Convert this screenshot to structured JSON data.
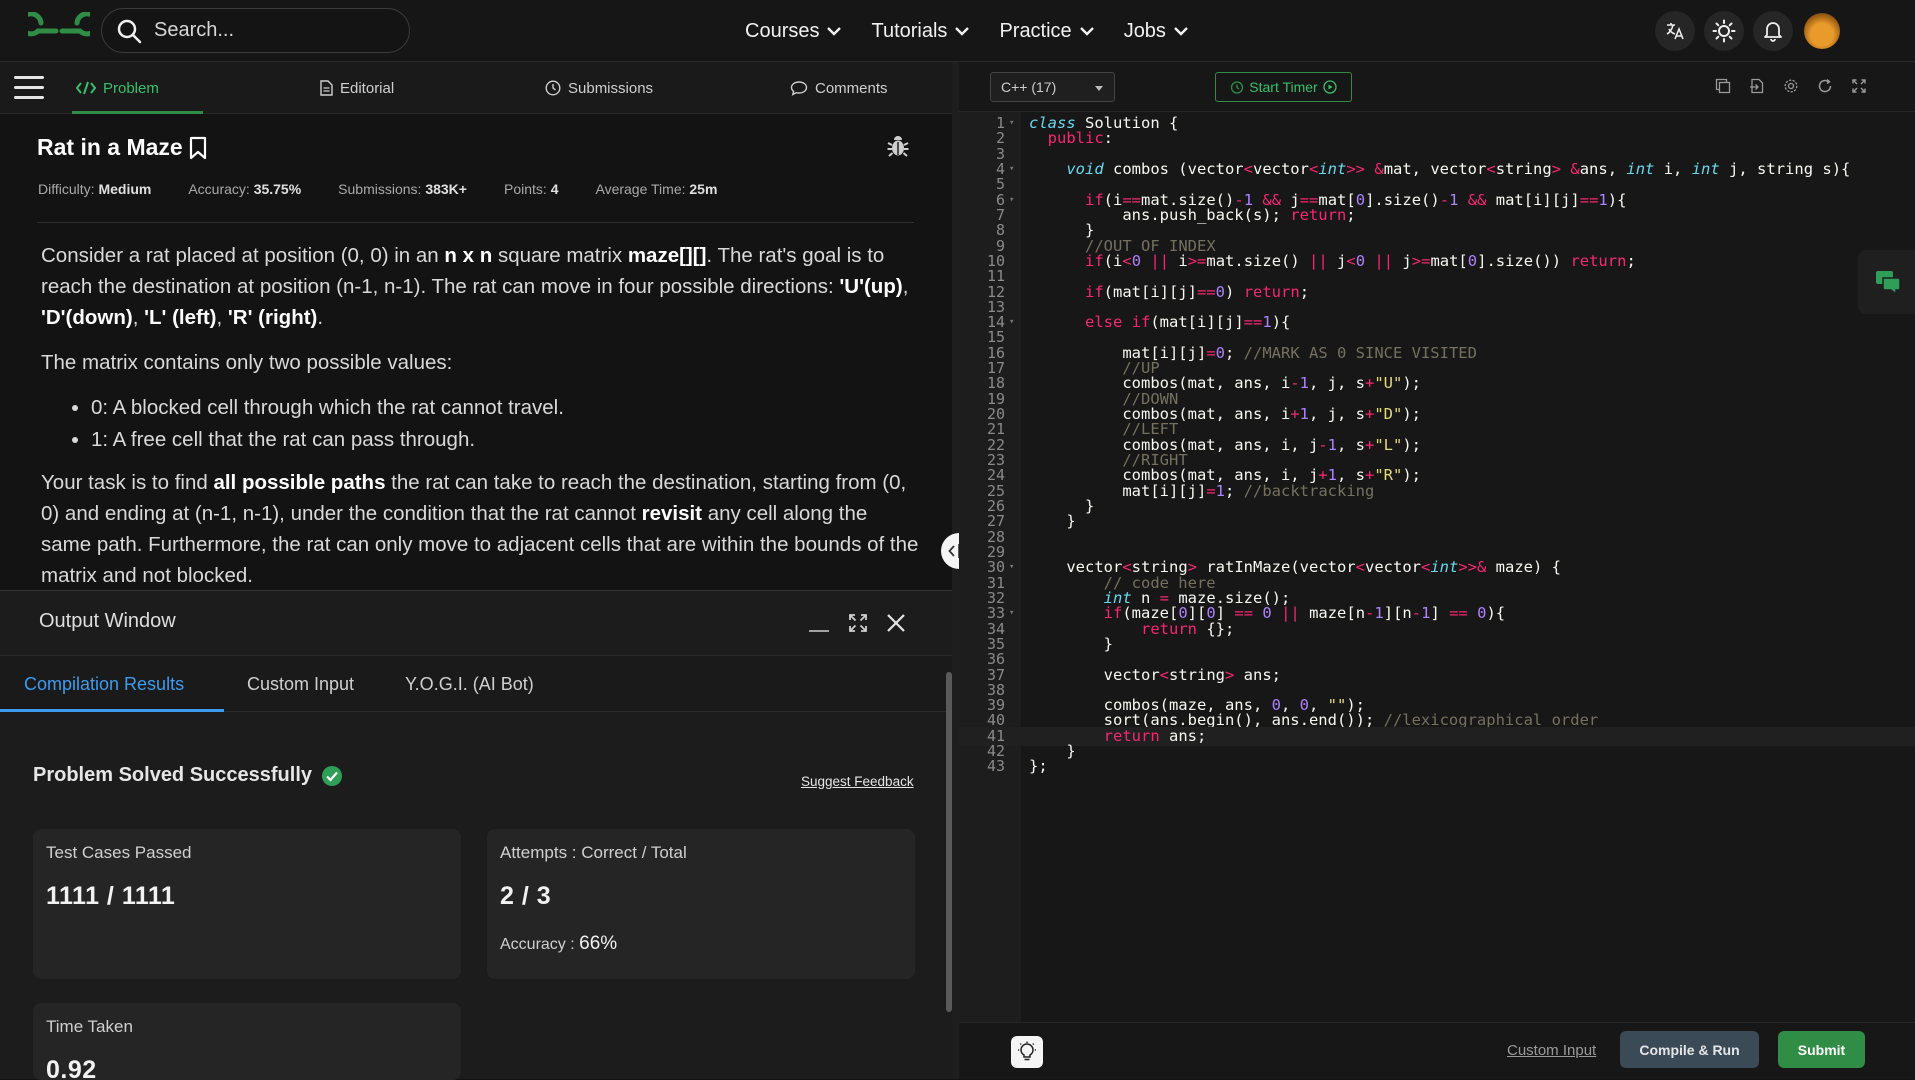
{
  "header": {
    "search_placeholder": "Search...",
    "nav": [
      "Courses",
      "Tutorials",
      "Practice",
      "Jobs"
    ]
  },
  "left_tabs": [
    {
      "label": "Problem",
      "icon": "code-icon",
      "active": true
    },
    {
      "label": "Editorial",
      "icon": "document-icon"
    },
    {
      "label": "Submissions",
      "icon": "clock-icon"
    },
    {
      "label": "Comments",
      "icon": "comment-icon"
    }
  ],
  "problem": {
    "title": "Rat in a Maze",
    "meta": {
      "difficulty_label": "Difficulty:",
      "difficulty": "Medium",
      "accuracy_label": "Accuracy:",
      "accuracy": "35.75%",
      "submissions_label": "Submissions:",
      "submissions": "383K+",
      "points_label": "Points:",
      "points": "4",
      "avg_time_label": "Average Time:",
      "avg_time": "25m"
    },
    "p1_a": "Consider a rat placed at position (0, 0) in an ",
    "p1_b": "n x n",
    "p1_c": " square matrix ",
    "p1_d": "maze[][]",
    "p1_e": ". The rat's goal is to reach the destination at position (n-1, n-1). The rat can move in four possible directions: ",
    "p1_f": "'U'(up)",
    "p1_g": ", ",
    "p1_h": "'D'(down)",
    "p1_i": ", ",
    "p1_j": "'L' (left)",
    "p1_k": ", ",
    "p1_l": "'R' (right)",
    "p1_m": ".",
    "p2": "The matrix contains only two possible values:",
    "li1": "0: A blocked cell through which the rat cannot travel.",
    "li2": "1: A free cell that the rat can pass through.",
    "p3_a": "Your task is to find ",
    "p3_b": "all possible paths",
    "p3_c": " the rat can take to reach the destination, starting from (0, 0) and ending at (n-1, n-1), under the condition that the rat cannot ",
    "p3_d": "revisit",
    "p3_e": " any cell along the same path. Furthermore, the rat can only move to adjacent cells that are within the bounds of the matrix and not blocked."
  },
  "output": {
    "title": "Output Window",
    "tabs": [
      "Compilation Results",
      "Custom Input",
      "Y.O.G.I. (AI Bot)"
    ],
    "status": "Problem Solved Successfully",
    "feedback": "Suggest Feedback",
    "test_cases_label": "Test Cases Passed",
    "test_cases_value": "1111 / 1111",
    "attempts_label": "Attempts : Correct / Total",
    "attempts_value": "2 / 3",
    "accuracy_label": "Accuracy : ",
    "accuracy_value": "66%",
    "time_label": "Time Taken",
    "time_value": "0.92"
  },
  "editor": {
    "language": "C++ (17)",
    "timer": "Start Timer",
    "custom_input": "Custom Input",
    "compile": "Compile & Run",
    "submit": "Submit",
    "active_line": 41
  },
  "colors": {
    "accent_green": "#2f8d46",
    "accent_blue": "#3d9bf0",
    "keyword": "#f92672",
    "type": "#66d9ef",
    "number": "#ae81ff",
    "string": "#e6db74",
    "comment": "#75715e"
  },
  "code": [
    {
      "n": 1,
      "fold": true,
      "s": [
        [
          "kwi",
          "class"
        ],
        [
          "t",
          " Solution {"
        ]
      ]
    },
    {
      "n": 2,
      "s": [
        [
          "t",
          "  "
        ],
        [
          "kw",
          "public"
        ],
        [
          "t",
          ":"
        ]
      ]
    },
    {
      "n": 3,
      "s": []
    },
    {
      "n": 4,
      "fold": true,
      "s": [
        [
          "t",
          "    "
        ],
        [
          "kwi",
          "void"
        ],
        [
          "t",
          " combos (vector"
        ],
        [
          "op",
          "<"
        ],
        [
          "t",
          "vector"
        ],
        [
          "op",
          "<"
        ],
        [
          "kwi",
          "int"
        ],
        [
          "op",
          ">>"
        ],
        [
          "t",
          " "
        ],
        [
          "op",
          "&"
        ],
        [
          "t",
          "mat, vector"
        ],
        [
          "op",
          "<"
        ],
        [
          "t",
          "string"
        ],
        [
          "op",
          ">"
        ],
        [
          "t",
          " "
        ],
        [
          "op",
          "&"
        ],
        [
          "t",
          "ans, "
        ],
        [
          "kwi",
          "int"
        ],
        [
          "t",
          " i, "
        ],
        [
          "kwi",
          "int"
        ],
        [
          "t",
          " j, string s){"
        ]
      ]
    },
    {
      "n": 5,
      "s": []
    },
    {
      "n": 6,
      "fold": true,
      "s": [
        [
          "t",
          "      "
        ],
        [
          "kw",
          "if"
        ],
        [
          "t",
          "(i"
        ],
        [
          "op",
          "=="
        ],
        [
          "t",
          "mat.size()"
        ],
        [
          "op",
          "-"
        ],
        [
          "num",
          "1"
        ],
        [
          "t",
          " "
        ],
        [
          "op",
          "&&"
        ],
        [
          "t",
          " j"
        ],
        [
          "op",
          "=="
        ],
        [
          "t",
          "mat["
        ],
        [
          "num",
          "0"
        ],
        [
          "t",
          "].size()"
        ],
        [
          "op",
          "-"
        ],
        [
          "num",
          "1"
        ],
        [
          "t",
          " "
        ],
        [
          "op",
          "&&"
        ],
        [
          "t",
          " mat[i][j]"
        ],
        [
          "op",
          "=="
        ],
        [
          "num",
          "1"
        ],
        [
          "t",
          "){"
        ]
      ]
    },
    {
      "n": 7,
      "s": [
        [
          "t",
          "          ans.push_back(s); "
        ],
        [
          "kw",
          "return"
        ],
        [
          "t",
          ";"
        ]
      ]
    },
    {
      "n": 8,
      "s": [
        [
          "t",
          "      }"
        ]
      ]
    },
    {
      "n": 9,
      "s": [
        [
          "t",
          "      "
        ],
        [
          "cm",
          "//OUT OF INDEX"
        ]
      ]
    },
    {
      "n": 10,
      "s": [
        [
          "t",
          "      "
        ],
        [
          "kw",
          "if"
        ],
        [
          "t",
          "(i"
        ],
        [
          "op",
          "<"
        ],
        [
          "num",
          "0"
        ],
        [
          "t",
          " "
        ],
        [
          "op",
          "||"
        ],
        [
          "t",
          " i"
        ],
        [
          "op",
          ">="
        ],
        [
          "t",
          "mat.size() "
        ],
        [
          "op",
          "||"
        ],
        [
          "t",
          " j"
        ],
        [
          "op",
          "<"
        ],
        [
          "num",
          "0"
        ],
        [
          "t",
          " "
        ],
        [
          "op",
          "||"
        ],
        [
          "t",
          " j"
        ],
        [
          "op",
          ">="
        ],
        [
          "t",
          "mat["
        ],
        [
          "num",
          "0"
        ],
        [
          "t",
          "].size()) "
        ],
        [
          "kw",
          "return"
        ],
        [
          "t",
          ";"
        ]
      ]
    },
    {
      "n": 11,
      "s": []
    },
    {
      "n": 12,
      "s": [
        [
          "t",
          "      "
        ],
        [
          "kw",
          "if"
        ],
        [
          "t",
          "(mat[i][j]"
        ],
        [
          "op",
          "=="
        ],
        [
          "num",
          "0"
        ],
        [
          "t",
          ") "
        ],
        [
          "kw",
          "return"
        ],
        [
          "t",
          ";"
        ]
      ]
    },
    {
      "n": 13,
      "s": []
    },
    {
      "n": 14,
      "fold": true,
      "s": [
        [
          "t",
          "      "
        ],
        [
          "kw",
          "else"
        ],
        [
          "t",
          " "
        ],
        [
          "kw",
          "if"
        ],
        [
          "t",
          "(mat[i][j]"
        ],
        [
          "op",
          "=="
        ],
        [
          "num",
          "1"
        ],
        [
          "t",
          "){"
        ]
      ]
    },
    {
      "n": 15,
      "s": []
    },
    {
      "n": 16,
      "s": [
        [
          "t",
          "          mat[i][j]"
        ],
        [
          "op",
          "="
        ],
        [
          "num",
          "0"
        ],
        [
          "t",
          "; "
        ],
        [
          "cm",
          "//MARK AS 0 SINCE VISITED"
        ]
      ]
    },
    {
      "n": 17,
      "s": [
        [
          "t",
          "          "
        ],
        [
          "cm",
          "//UP"
        ]
      ]
    },
    {
      "n": 18,
      "s": [
        [
          "t",
          "          combos(mat, ans, i"
        ],
        [
          "op",
          "-"
        ],
        [
          "num",
          "1"
        ],
        [
          "t",
          ", j, s"
        ],
        [
          "op",
          "+"
        ],
        [
          "str",
          "\"U\""
        ],
        [
          "t",
          ");"
        ]
      ]
    },
    {
      "n": 19,
      "s": [
        [
          "t",
          "          "
        ],
        [
          "cm",
          "//DOWN"
        ]
      ]
    },
    {
      "n": 20,
      "s": [
        [
          "t",
          "          combos(mat, ans, i"
        ],
        [
          "op",
          "+"
        ],
        [
          "num",
          "1"
        ],
        [
          "t",
          ", j, s"
        ],
        [
          "op",
          "+"
        ],
        [
          "str",
          "\"D\""
        ],
        [
          "t",
          ");"
        ]
      ]
    },
    {
      "n": 21,
      "s": [
        [
          "t",
          "          "
        ],
        [
          "cm",
          "//LEFT"
        ]
      ]
    },
    {
      "n": 22,
      "s": [
        [
          "t",
          "          combos(mat, ans, i, j"
        ],
        [
          "op",
          "-"
        ],
        [
          "num",
          "1"
        ],
        [
          "t",
          ", s"
        ],
        [
          "op",
          "+"
        ],
        [
          "str",
          "\"L\""
        ],
        [
          "t",
          ");"
        ]
      ]
    },
    {
      "n": 23,
      "s": [
        [
          "t",
          "          "
        ],
        [
          "cm",
          "//RIGHT"
        ]
      ]
    },
    {
      "n": 24,
      "s": [
        [
          "t",
          "          combos(mat, ans, i, j"
        ],
        [
          "op",
          "+"
        ],
        [
          "num",
          "1"
        ],
        [
          "t",
          ", s"
        ],
        [
          "op",
          "+"
        ],
        [
          "str",
          "\"R\""
        ],
        [
          "t",
          ");"
        ]
      ]
    },
    {
      "n": 25,
      "s": [
        [
          "t",
          "          mat[i][j]"
        ],
        [
          "op",
          "="
        ],
        [
          "num",
          "1"
        ],
        [
          "t",
          "; "
        ],
        [
          "cm",
          "//backtracking"
        ]
      ]
    },
    {
      "n": 26,
      "s": [
        [
          "t",
          "      }"
        ]
      ]
    },
    {
      "n": 27,
      "s": [
        [
          "t",
          "    }"
        ]
      ]
    },
    {
      "n": 28,
      "s": []
    },
    {
      "n": 29,
      "s": []
    },
    {
      "n": 30,
      "fold": true,
      "s": [
        [
          "t",
          "    vector"
        ],
        [
          "op",
          "<"
        ],
        [
          "t",
          "string"
        ],
        [
          "op",
          ">"
        ],
        [
          "t",
          " ratInMaze(vector"
        ],
        [
          "op",
          "<"
        ],
        [
          "t",
          "vector"
        ],
        [
          "op",
          "<"
        ],
        [
          "kwi",
          "int"
        ],
        [
          "op",
          ">>&"
        ],
        [
          "t",
          " maze) {"
        ]
      ]
    },
    {
      "n": 31,
      "s": [
        [
          "t",
          "        "
        ],
        [
          "cm",
          "// code here"
        ]
      ]
    },
    {
      "n": 32,
      "s": [
        [
          "t",
          "        "
        ],
        [
          "kwi",
          "int"
        ],
        [
          "t",
          " n "
        ],
        [
          "op",
          "="
        ],
        [
          "t",
          " maze.size();"
        ]
      ]
    },
    {
      "n": 33,
      "fold": true,
      "s": [
        [
          "t",
          "        "
        ],
        [
          "kw",
          "if"
        ],
        [
          "t",
          "(maze["
        ],
        [
          "num",
          "0"
        ],
        [
          "t",
          "]["
        ],
        [
          "num",
          "0"
        ],
        [
          "t",
          "] "
        ],
        [
          "op",
          "=="
        ],
        [
          "t",
          " "
        ],
        [
          "num",
          "0"
        ],
        [
          "t",
          " "
        ],
        [
          "op",
          "||"
        ],
        [
          "t",
          " maze[n"
        ],
        [
          "op",
          "-"
        ],
        [
          "num",
          "1"
        ],
        [
          "t",
          "][n"
        ],
        [
          "op",
          "-"
        ],
        [
          "num",
          "1"
        ],
        [
          "t",
          "] "
        ],
        [
          "op",
          "=="
        ],
        [
          "t",
          " "
        ],
        [
          "num",
          "0"
        ],
        [
          "t",
          "){"
        ]
      ]
    },
    {
      "n": 34,
      "s": [
        [
          "t",
          "            "
        ],
        [
          "kw",
          "return"
        ],
        [
          "t",
          " {};"
        ]
      ]
    },
    {
      "n": 35,
      "s": [
        [
          "t",
          "        }"
        ]
      ]
    },
    {
      "n": 36,
      "s": []
    },
    {
      "n": 37,
      "s": [
        [
          "t",
          "        vector"
        ],
        [
          "op",
          "<"
        ],
        [
          "t",
          "string"
        ],
        [
          "op",
          ">"
        ],
        [
          "t",
          " ans;"
        ]
      ]
    },
    {
      "n": 38,
      "s": []
    },
    {
      "n": 39,
      "s": [
        [
          "t",
          "        combos(maze, ans, "
        ],
        [
          "num",
          "0"
        ],
        [
          "t",
          ", "
        ],
        [
          "num",
          "0"
        ],
        [
          "t",
          ", "
        ],
        [
          "str",
          "\"\""
        ],
        [
          "t",
          ");"
        ]
      ]
    },
    {
      "n": 40,
      "s": [
        [
          "t",
          "        sort(ans.begin(), ans.end()); "
        ],
        [
          "cm",
          "//lexicographical order"
        ]
      ]
    },
    {
      "n": 41,
      "s": [
        [
          "t",
          "        "
        ],
        [
          "kw",
          "return"
        ],
        [
          "t",
          " ans;"
        ]
      ]
    },
    {
      "n": 42,
      "s": [
        [
          "t",
          "    }"
        ]
      ]
    },
    {
      "n": 43,
      "s": [
        [
          "t",
          "};"
        ]
      ]
    }
  ]
}
